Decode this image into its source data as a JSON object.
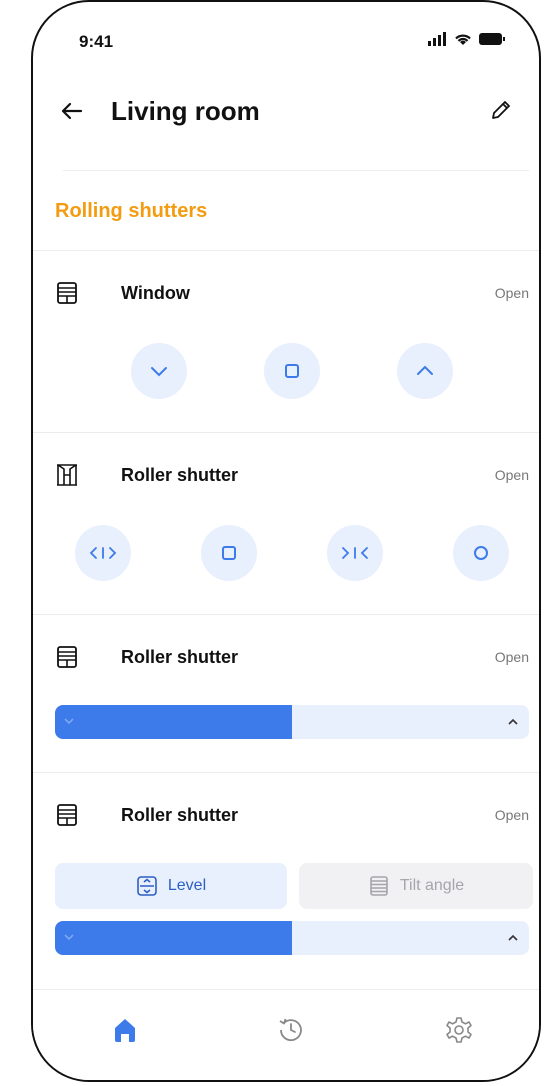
{
  "status_bar": {
    "time": "9:41"
  },
  "header": {
    "title": "Living room"
  },
  "section": {
    "title": "Rolling shutters"
  },
  "devices": [
    {
      "name": "Window",
      "status": "Open",
      "icon": "shutter-icon",
      "buttons": [
        "chevron-down-icon",
        "stop-icon",
        "chevron-up-icon"
      ]
    },
    {
      "name": "Roller shutter",
      "status": "Open",
      "icon": "curtain-icon",
      "buttons": [
        "open-icon",
        "stop-icon",
        "close-icon",
        "circle-icon"
      ]
    },
    {
      "name": "Roller shutter",
      "status": "Open",
      "icon": "shutter-icon",
      "level_percent": 50
    },
    {
      "name": "Roller shutter",
      "status": "Open",
      "icon": "shutter-icon",
      "tabs": [
        "Level",
        "Tilt angle"
      ],
      "selected_tab": "Level",
      "level_percent": 50
    }
  ],
  "colors": {
    "accent": "#f39c12",
    "primary": "#3d7bea",
    "button_bg": "#e8effd"
  },
  "nav": {
    "items": [
      "home-icon",
      "history-icon",
      "settings-icon"
    ],
    "active": "home-icon"
  }
}
